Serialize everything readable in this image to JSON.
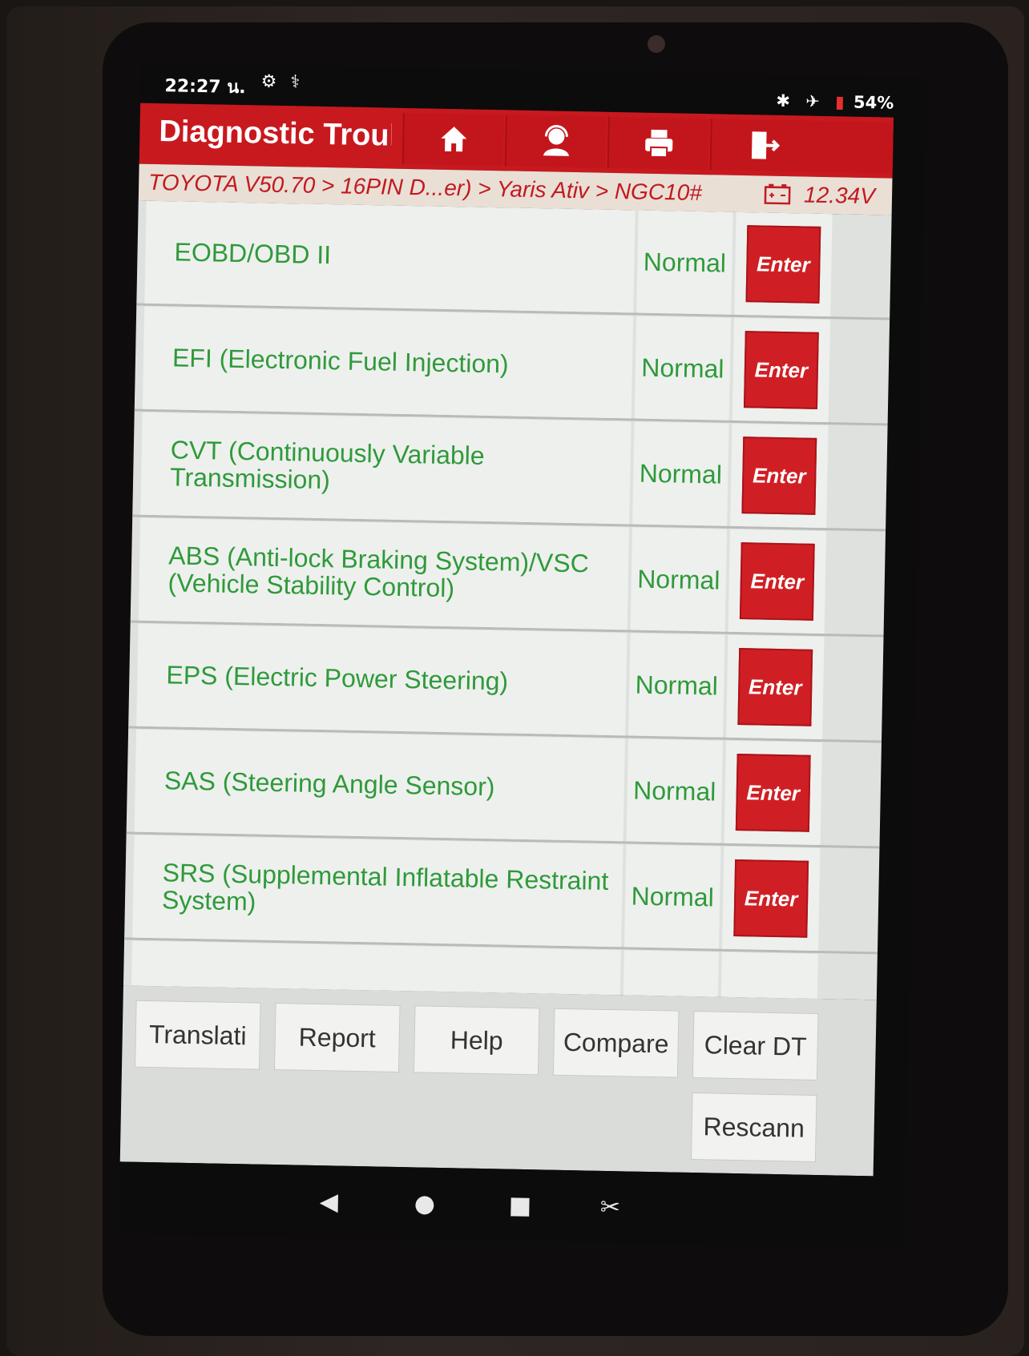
{
  "status_bar": {
    "time": "22:27 น.",
    "battery": "54%",
    "icons": [
      "settings-icon",
      "stethoscope-icon",
      "bluetooth-icon",
      "airplane-icon",
      "battery-icon"
    ]
  },
  "header": {
    "title": "Diagnostic Troul",
    "buttons": [
      "home-icon",
      "support-icon",
      "print-icon",
      "exit-icon"
    ],
    "color": "#c8191f"
  },
  "breadcrumb": {
    "path": "TOYOTA V50.70 > 16PIN D...er) > Yaris Ativ > NGC10#",
    "voltage": "12.34V"
  },
  "systems": [
    {
      "name": "EOBD/OBD II",
      "status": "Normal",
      "action": "Enter"
    },
    {
      "name": "EFI (Electronic Fuel Injection)",
      "status": "Normal",
      "action": "Enter"
    },
    {
      "name": "CVT (Continuously Variable Transmission)",
      "status": "Normal",
      "action": "Enter"
    },
    {
      "name": "ABS (Anti-lock Braking System)/VSC (Vehicle Stability Control)",
      "status": "Normal",
      "action": "Enter"
    },
    {
      "name": "EPS (Electric Power Steering)",
      "status": "Normal",
      "action": "Enter"
    },
    {
      "name": "SAS (Steering Angle Sensor)",
      "status": "Normal",
      "action": "Enter"
    },
    {
      "name": "SRS (Supplemental Inflatable Restraint System)",
      "status": "Normal",
      "action": "Enter"
    }
  ],
  "toolbar": {
    "translate": "Translati",
    "report": "Report",
    "help": "Help",
    "compare": "Compare",
    "clear_dtc": "Clear DT",
    "rescan": "Rescann"
  },
  "colors": {
    "accent": "#c8191f",
    "status_text": "#2f9a3a",
    "enter_button": "#d01f24"
  }
}
